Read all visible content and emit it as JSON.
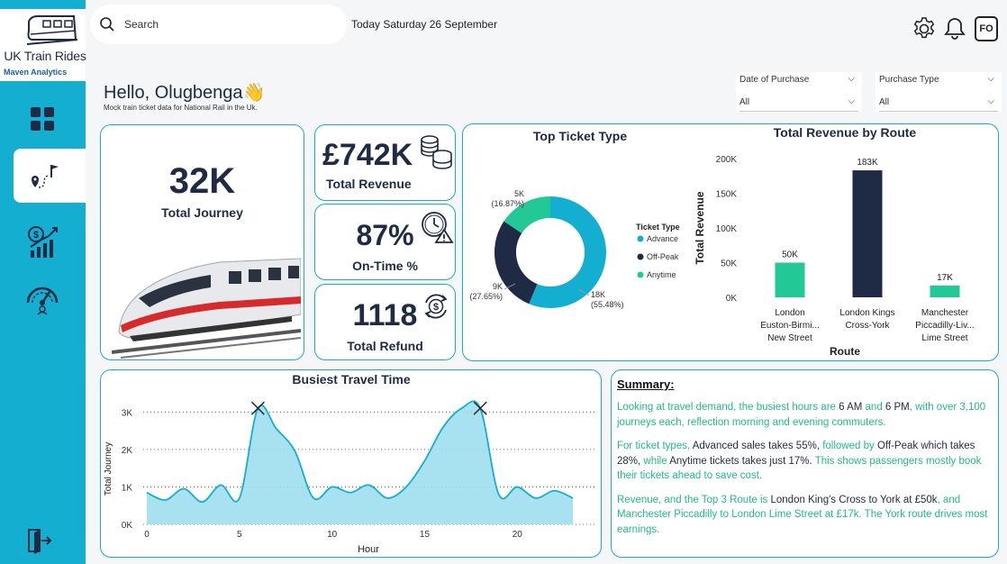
{
  "app": {
    "title": "UK Train Rides",
    "subtitle": "Maven Analytics"
  },
  "topbar": {
    "search_placeholder": "Search",
    "date": "Today Saturday 26 September",
    "avatar": "FO"
  },
  "greeting": {
    "title": "Hello, Olugbenga",
    "emoji": "👋",
    "subtitle": "Mock train ticket data for National Rail in the Uk."
  },
  "filters": [
    {
      "label": "Date of Purchase",
      "value": "All"
    },
    {
      "label": "Purchase Type",
      "value": "All"
    }
  ],
  "kpis": {
    "journey": {
      "value": "32K",
      "label": "Total Journey"
    },
    "revenue": {
      "value": "£742K",
      "label": "Total Revenue"
    },
    "ontime": {
      "value": "87%",
      "label": "On-Time %"
    },
    "refund": {
      "value": "1118",
      "label": "Total Refund"
    }
  },
  "colors": {
    "accent": "#14aed0",
    "navy": "#1f2a44",
    "green": "#22c997",
    "area": "#9fdff0"
  },
  "summary": {
    "title": "Summary:",
    "p1": [
      {
        "t": "Looking at travel demand, the busiest hours are ",
        "c": "g"
      },
      {
        "t": "6 AM",
        "c": "d"
      },
      {
        "t": " and ",
        "c": "g"
      },
      {
        "t": "6 PM",
        "c": "d"
      },
      {
        "t": ", with over 3,100 journeys each, reflection morning and evening commuters.",
        "c": "g"
      }
    ],
    "p2": [
      {
        "t": "For ticket types, ",
        "c": "g"
      },
      {
        "t": "Advanced sales takes 55%,",
        "c": "d"
      },
      {
        "t": " followed by ",
        "c": "g"
      },
      {
        "t": "Off-Peak which takes 28%,",
        "c": "d"
      },
      {
        "t": " while ",
        "c": "g"
      },
      {
        "t": "Anytime tickets takes just 17%.",
        "c": "d"
      },
      {
        "t": " This shows passengers mostly book their tickets ahead to save cost.",
        "c": "g"
      }
    ],
    "p3": [
      {
        "t": "Revenue, and the Top 3 Route is ",
        "c": "g"
      },
      {
        "t": "London King's Cross to York at £50k",
        "c": "d"
      },
      {
        "t": ", and Manchester Piccadilly to London Lime Street at £17k. The York route drives most earnings.",
        "c": "g"
      }
    ]
  },
  "chart_data": [
    {
      "type": "donut",
      "title": "Top Ticket Type",
      "legend_title": "Ticket Type",
      "legend_position": "right",
      "slices": [
        {
          "name": "Advance",
          "value": 18000,
          "label": "18K",
          "pct_label": "(55.48%)",
          "color": "#14aed0"
        },
        {
          "name": "Off-Peak",
          "value": 9000,
          "label": "9K",
          "pct_label": "(27.65%)",
          "color": "#1f2a44"
        },
        {
          "name": "Anytime",
          "value": 5000,
          "label": "5K",
          "pct_label": "(16.87%)",
          "color": "#22c997"
        }
      ]
    },
    {
      "type": "bar",
      "title": "Total Revenue by Route",
      "xlabel": "Route",
      "ylabel": "Total Revenue",
      "ylim": [
        0,
        200000
      ],
      "yticks": [
        "0K",
        "50K",
        "100K",
        "150K",
        "200K"
      ],
      "categories": [
        [
          "London",
          "Euston-Birmi...",
          "New Street"
        ],
        [
          "London Kings",
          "Cross-York"
        ],
        [
          "Manchester",
          "Piccadilly-Liv...",
          "Lime Street"
        ]
      ],
      "values": [
        50000,
        183000,
        17000
      ],
      "labels": [
        "50K",
        "183K",
        "17K"
      ],
      "colors": [
        "#22c997",
        "#1f2a44",
        "#22c997"
      ]
    },
    {
      "type": "area",
      "title": "Busiest Travel Time",
      "xlabel": "Hour",
      "ylabel": "Total Journey",
      "xlim": [
        0,
        23
      ],
      "ylim": [
        0,
        3200
      ],
      "xticks": [
        "0",
        "5",
        "10",
        "15",
        "20"
      ],
      "yticks": [
        "0K",
        "1K",
        "2K",
        "3K"
      ],
      "x": [
        0,
        1,
        2,
        3,
        4,
        5,
        6,
        7,
        8,
        9,
        10,
        11,
        12,
        13,
        14,
        15,
        16,
        17,
        18,
        19,
        20,
        21,
        22,
        23
      ],
      "values": [
        850,
        650,
        950,
        600,
        1050,
        700,
        3100,
        2550,
        1950,
        700,
        1000,
        850,
        1050,
        700,
        1000,
        1700,
        2600,
        3100,
        3100,
        800,
        1000,
        700,
        900,
        700
      ],
      "peaks": [
        6,
        18
      ]
    }
  ]
}
